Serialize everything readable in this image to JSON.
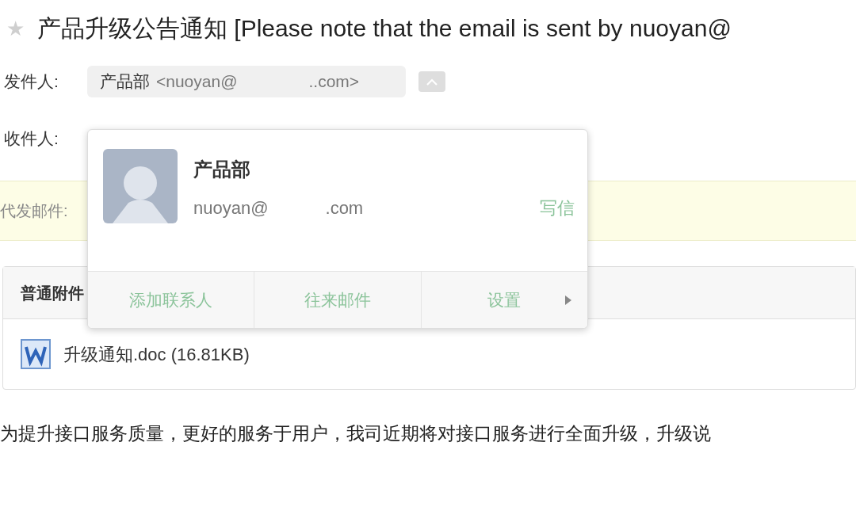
{
  "mail": {
    "star": "★",
    "subject": "产品升级公告通知 [Please note that the email is sent by nuoyan@"
  },
  "sender": {
    "label": "发件人:",
    "name": "产品部",
    "address_start": "<nuoyan@",
    "address_end": "..com>"
  },
  "recipient": {
    "label": "收件人:"
  },
  "proxy_notice": {
    "label": "代发邮件:"
  },
  "contact_card": {
    "name": "产品部",
    "email_start": "nuoyan@",
    "email_end": ".com",
    "write_link": "写信",
    "actions": [
      {
        "label": "添加联系人",
        "kind": "plain"
      },
      {
        "label": "往来邮件",
        "kind": "plain"
      },
      {
        "label": "设置",
        "kind": "submenu"
      }
    ]
  },
  "attachments": {
    "title": "普通附件",
    "files": [
      {
        "name": "升级通知.doc (16.81KB)"
      }
    ]
  },
  "body": "为提升接口服务质量，更好的服务于用户，我司近期将对接口服务进行全面升级，升级说"
}
